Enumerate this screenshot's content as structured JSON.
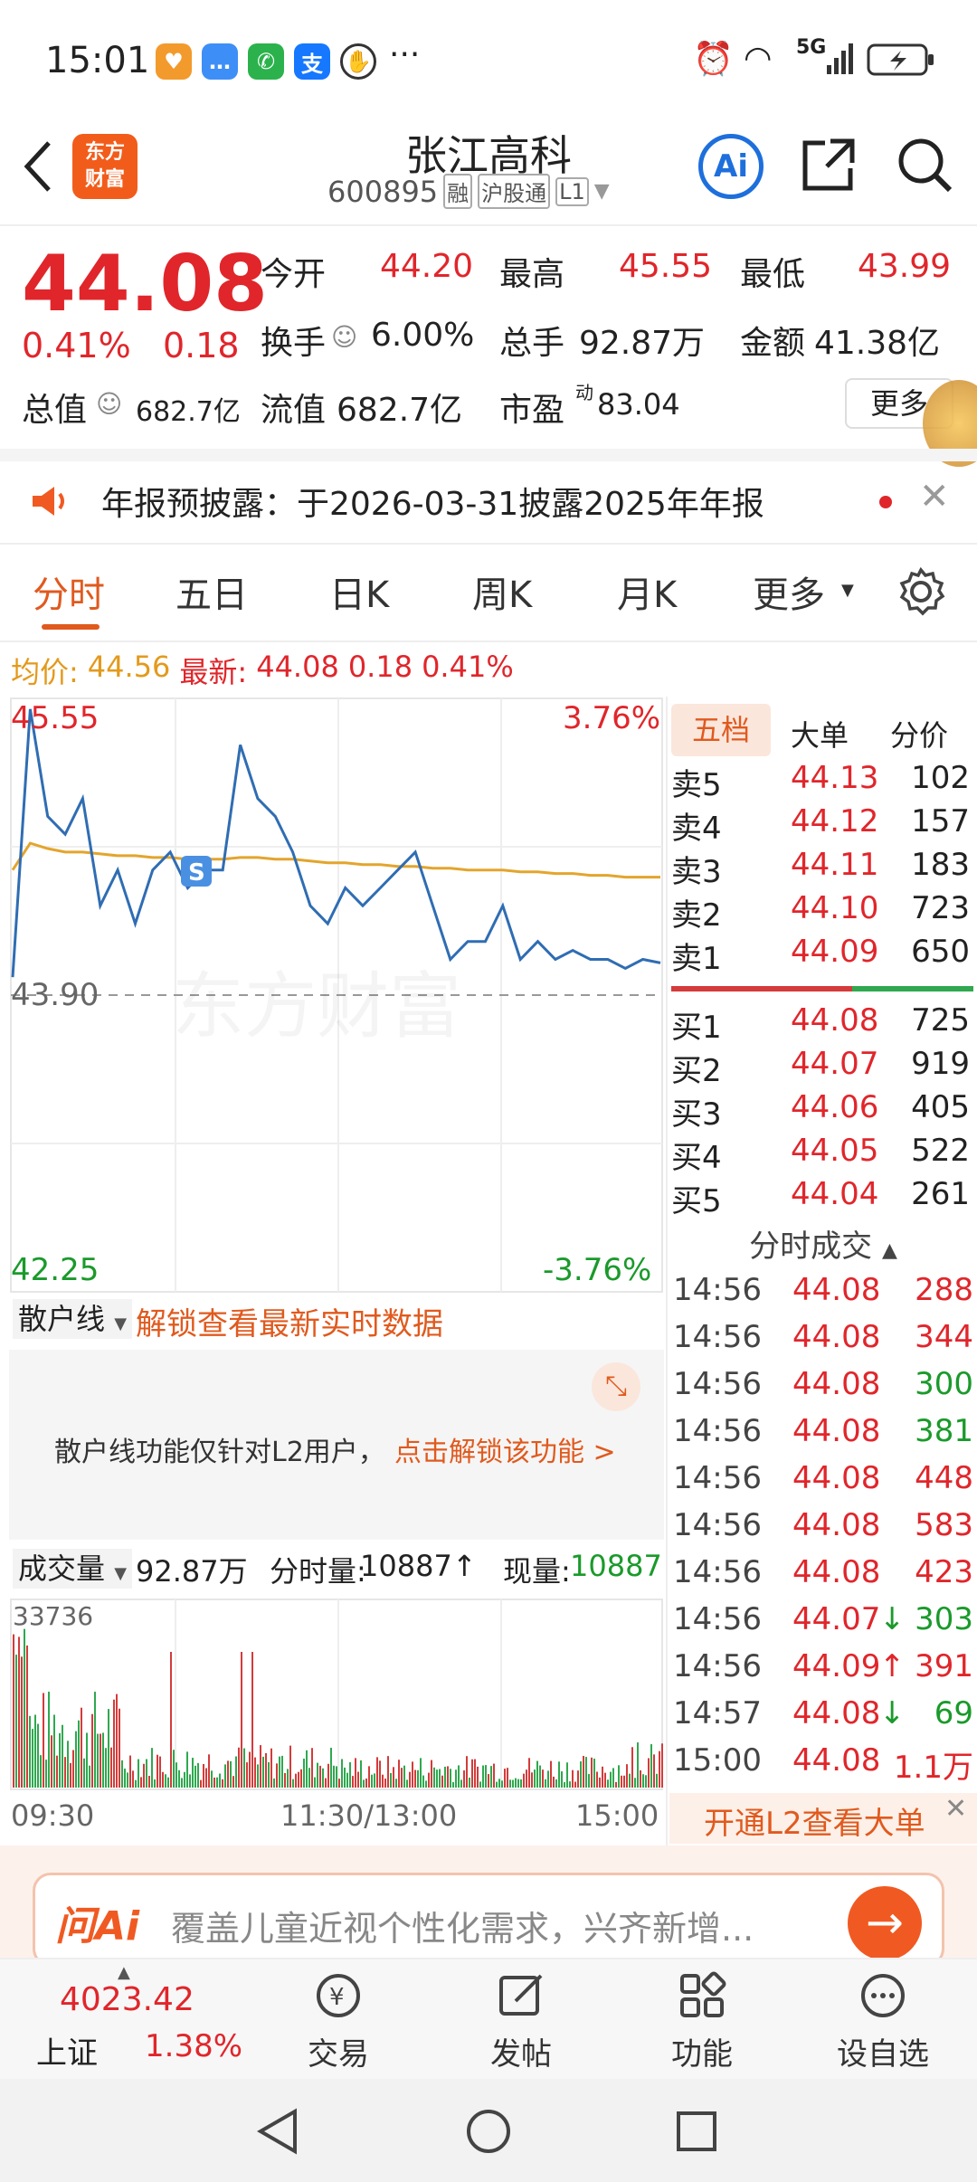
{
  "status_bar": {
    "time": "15:01",
    "network": "5G"
  },
  "header": {
    "title": "张江高科",
    "code": "600895",
    "badge_rong": "融",
    "badge_hgt": "沪股通",
    "badge_level": "L1",
    "brand_line1": "东方",
    "brand_line2": "财富",
    "ai_label": "Ai"
  },
  "quote": {
    "price": "44.08",
    "change_pct": "0.41%",
    "change": "0.18",
    "open_label": "今开",
    "open": "44.20",
    "high_label": "最高",
    "high": "45.55",
    "low_label": "最低",
    "low": "43.99",
    "turnover_label": "换手",
    "turnover": "6.00%",
    "volume_label": "总手",
    "volume": "92.87万",
    "amount_label": "金额",
    "amount": "41.38亿",
    "mktcap_label": "总值",
    "mktcap": "682.7亿",
    "float_label": "流值",
    "float": "682.7亿",
    "pe_label": "市盈",
    "pe_sup": "动",
    "pe": "83.04",
    "more": "更多"
  },
  "notice": {
    "text": "年报预披露：于2026-03-31披露2025年年报"
  },
  "tabs": [
    "分时",
    "五日",
    "日K",
    "周K",
    "月K",
    "更多"
  ],
  "chart_info": {
    "avg_label": "均价:",
    "avg": "44.56",
    "latest_label": "最新:",
    "latest": "44.08",
    "change": "0.18",
    "change_pct": "0.41%"
  },
  "chart_data": {
    "type": "line",
    "x": [
      "09:30",
      "11:30/13:00",
      "15:00"
    ],
    "y_top": "45.55",
    "y_mid": "43.90",
    "y_bottom": "42.25",
    "pct_top": "3.76%",
    "pct_bottom": "-3.76%",
    "watermark": "东方财富",
    "marker": "S",
    "ylim": [
      42.25,
      45.55
    ],
    "series": [
      {
        "values": [
          44.0,
          45.5,
          44.9,
          44.8,
          45.0,
          44.4,
          44.6,
          44.3,
          44.6,
          44.7,
          44.5,
          44.6,
          44.6,
          45.3,
          45.0,
          44.9,
          44.7,
          44.4,
          44.3,
          44.5,
          44.4,
          44.5,
          44.6,
          44.7,
          44.4,
          44.1,
          44.2,
          44.2,
          44.4,
          44.1,
          44.2,
          44.1,
          44.15,
          44.1,
          44.1,
          44.05,
          44.1,
          44.08
        ]
      },
      {
        "values": [
          44.6,
          44.75,
          44.72,
          44.7,
          44.7,
          44.69,
          44.68,
          44.68,
          44.67,
          44.67,
          44.66,
          44.66,
          44.66,
          44.67,
          44.67,
          44.66,
          44.66,
          44.65,
          44.64,
          44.64,
          44.63,
          44.63,
          44.62,
          44.62,
          44.61,
          44.61,
          44.6,
          44.6,
          44.6,
          44.59,
          44.59,
          44.58,
          44.58,
          44.57,
          44.57,
          44.56,
          44.56,
          44.56
        ]
      }
    ]
  },
  "retail_line": {
    "label": "散户线",
    "unlock": "解锁查看最新实时数据",
    "info": "散户线功能仅针对L2用户，",
    "info_link": "点击解锁该功能 >"
  },
  "volume_bar": {
    "label": "成交量",
    "total": "92.87万",
    "fs_label": "分时量:",
    "fs_value": "10887",
    "now_label": "现量:",
    "now_value": "10887",
    "max": "33736",
    "xaxis": [
      "09:30",
      "11:30/13:00",
      "15:00"
    ]
  },
  "orderbook": {
    "tabs": [
      "五档",
      "大单",
      "分价"
    ],
    "asks": [
      {
        "label": "卖5",
        "price": "44.13",
        "vol": "102"
      },
      {
        "label": "卖4",
        "price": "44.12",
        "vol": "157"
      },
      {
        "label": "卖3",
        "price": "44.11",
        "vol": "183"
      },
      {
        "label": "卖2",
        "price": "44.10",
        "vol": "723"
      },
      {
        "label": "卖1",
        "price": "44.09",
        "vol": "650"
      }
    ],
    "bids": [
      {
        "label": "买1",
        "price": "44.08",
        "vol": "725"
      },
      {
        "label": "买2",
        "price": "44.07",
        "vol": "919"
      },
      {
        "label": "买3",
        "price": "44.06",
        "vol": "405"
      },
      {
        "label": "买4",
        "price": "44.05",
        "vol": "522"
      },
      {
        "label": "买5",
        "price": "44.04",
        "vol": "261"
      }
    ]
  },
  "trades": {
    "title": "分时成交",
    "rows": [
      {
        "time": "14:56",
        "price": "44.08",
        "arrow": "",
        "vol": "288"
      },
      {
        "time": "14:56",
        "price": "44.08",
        "arrow": "",
        "vol": "344"
      },
      {
        "time": "14:56",
        "price": "44.08",
        "arrow": "",
        "vol": "300"
      },
      {
        "time": "14:56",
        "price": "44.08",
        "arrow": "",
        "vol": "381"
      },
      {
        "time": "14:56",
        "price": "44.08",
        "arrow": "",
        "vol": "448"
      },
      {
        "time": "14:56",
        "price": "44.08",
        "arrow": "",
        "vol": "583"
      },
      {
        "time": "14:56",
        "price": "44.08",
        "arrow": "",
        "vol": "423"
      },
      {
        "time": "14:56",
        "price": "44.07",
        "arrow": "↓",
        "vol": "303"
      },
      {
        "time": "14:56",
        "price": "44.09",
        "arrow": "↑",
        "vol": "391"
      },
      {
        "time": "14:57",
        "price": "44.08",
        "arrow": "↓",
        "vol": "69"
      },
      {
        "time": "15:00",
        "price": "44.08",
        "arrow": "",
        "vol": "1.1万"
      }
    ],
    "l2_link": "开通L2查看大单"
  },
  "ai_bar": {
    "logo": "问Ai",
    "placeholder": "覆盖儿童近视个性化需求，兴齐新增..."
  },
  "bottom_nav": {
    "index_value": "4023.42",
    "index_name": "上证",
    "index_pct": "1.38%",
    "items": [
      "交易",
      "发帖",
      "功能",
      "设自选"
    ]
  }
}
